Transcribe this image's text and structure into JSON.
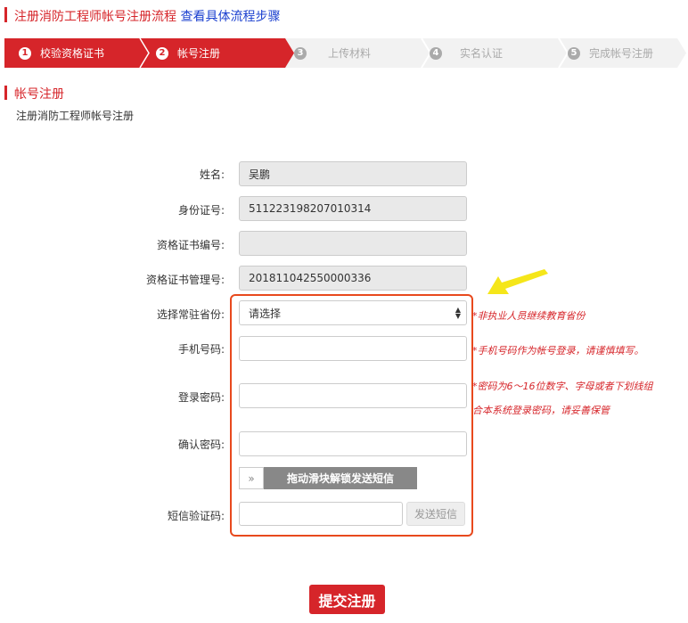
{
  "header": {
    "title": "注册消防工程师帐号注册流程",
    "link": "查看具体流程步骤"
  },
  "steps": [
    {
      "num": "1",
      "label": "校验资格证书",
      "state": "done"
    },
    {
      "num": "2",
      "label": "帐号注册",
      "state": "active"
    },
    {
      "num": "3",
      "label": "上传材料",
      "state": "pending"
    },
    {
      "num": "4",
      "label": "实名认证",
      "state": "pending"
    },
    {
      "num": "5",
      "label": "完成帐号注册",
      "state": "pending"
    }
  ],
  "section": {
    "title": "帐号注册",
    "subtitle": "注册消防工程师帐号注册"
  },
  "form": {
    "name_label": "姓名:",
    "name_value": "吴鹏",
    "id_label": "身份证号:",
    "id_value": "511223198207010314",
    "cert_no_label": "资格证书编号:",
    "cert_no_value": "",
    "cert_mgmt_label": "资格证书管理号:",
    "cert_mgmt_value": "201811042550000336",
    "province_label": "选择常驻省份:",
    "province_value": "请选择",
    "phone_label": "手机号码:",
    "phone_value": "",
    "password_label": "登录密码:",
    "password_value": "",
    "confirm_label": "确认密码:",
    "confirm_value": "",
    "slider_handle": "»",
    "slider_text": "拖动滑块解锁发送短信",
    "sms_label": "短信验证码:",
    "sms_value": "",
    "sms_button": "发送短信",
    "submit": "提交注册"
  },
  "hints": {
    "province": "*非执业人员继续教育省份",
    "phone": "*手机号码作为帐号登录，请谨慎填写。",
    "password1": "*密码为6～16位数字、字母或者下划线组",
    "password2": "合本系统登录密码，请妥善保管"
  },
  "colors": {
    "accent": "#d6252a",
    "highlight_box": "#e8491d",
    "arrow": "#f5e61a"
  }
}
